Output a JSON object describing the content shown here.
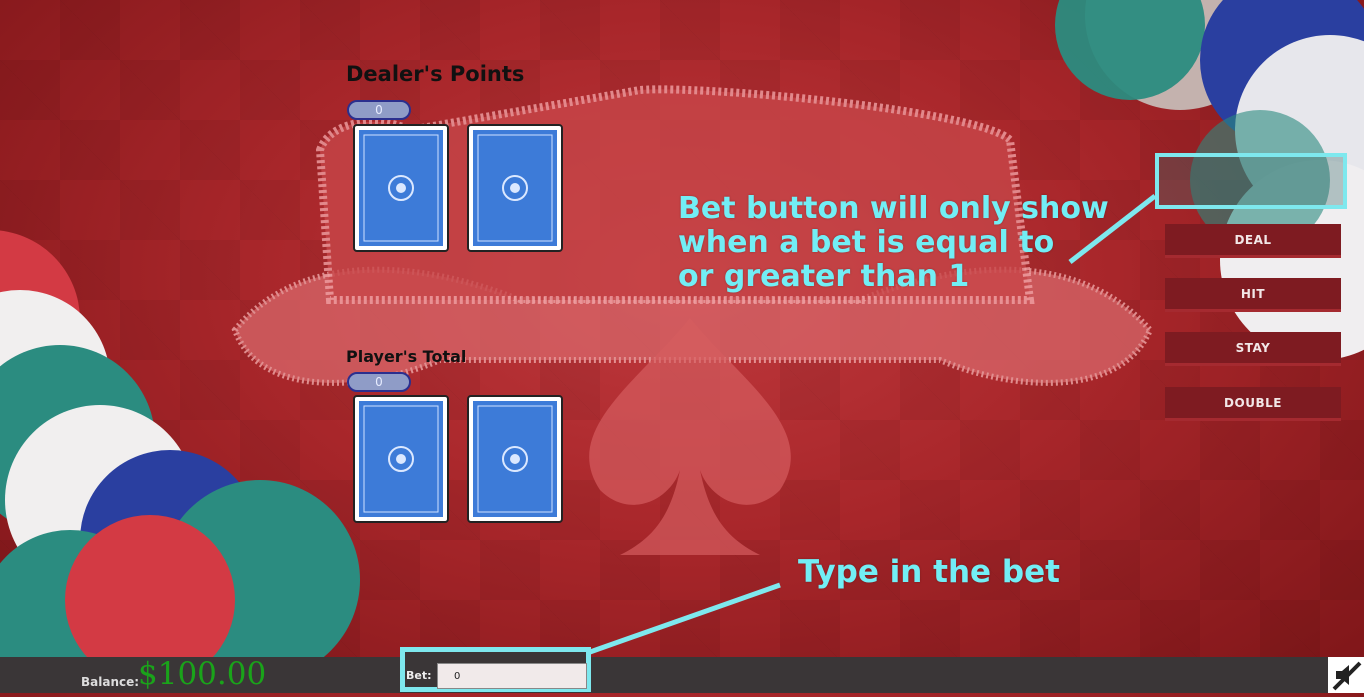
{
  "dealer": {
    "title": "Dealer's Points",
    "points": "0"
  },
  "player": {
    "title": "Player's Total",
    "points": "0"
  },
  "buttons": {
    "deal": "DEAL",
    "hit": "HIT",
    "stay": "STAY",
    "double": "DOUBLE"
  },
  "annotations": {
    "bet_button_note_line1": "Bet button will only show",
    "bet_button_note_line2": "when a bet is equal to",
    "bet_button_note_line3": "or greater than 1",
    "type_bet_note": "Type in the bet"
  },
  "footer": {
    "balance_label": "Balance:",
    "balance_value": "$100.00",
    "bet_label": "Bet:",
    "bet_value": "0"
  },
  "colors": {
    "accent_annotation": "#72eef5",
    "button_bg": "#7e1b21",
    "balance_green": "#1aa31a"
  },
  "icons": {
    "mute": "speaker-muted-icon"
  }
}
